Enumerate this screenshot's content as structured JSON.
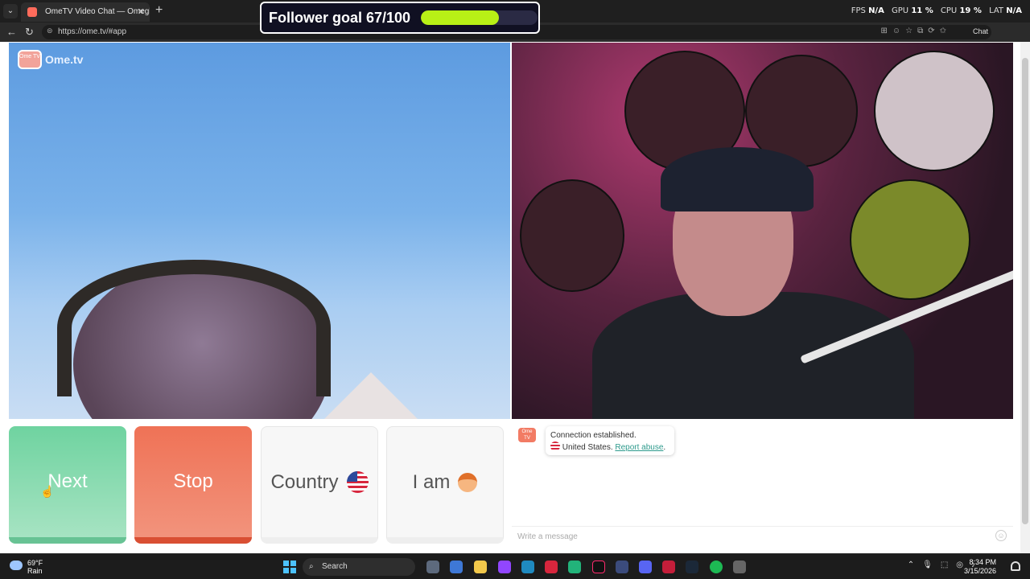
{
  "browser": {
    "tab_title": "OmeTV Video Chat — Omegl",
    "tab_close": "✕",
    "new_tab": "+",
    "url": "https://ome.tv/#app",
    "chat_label": "Chat"
  },
  "stats": {
    "fps_label": "FPS",
    "fps_value": "N/A",
    "gpu_label": "GPU",
    "gpu_value": "11 %",
    "cpu_label": "CPU",
    "cpu_value": "19 %",
    "lat_label": "LAT",
    "lat_value": "N/A"
  },
  "goal": {
    "text": "Follower goal 67/100",
    "current": 67,
    "target": 100,
    "color": "#b8f016"
  },
  "logo": {
    "badge": "Ome TV",
    "name": "Ome.tv"
  },
  "buttons": {
    "next": "Next",
    "stop": "Stop",
    "country": "Country",
    "i_am": "I am"
  },
  "chat": {
    "system_line": "Connection established.",
    "country": "United States.",
    "report": "Report abuse",
    "placeholder": "Write a message"
  },
  "taskbar": {
    "temp": "69°F",
    "condition": "Rain",
    "search": "Search",
    "time": "8:34 PM",
    "date": "3/15/2026"
  },
  "colors": {
    "next": "#6fd3a0",
    "stop": "#ef7256",
    "accent": "#2d9a8c"
  },
  "icons": [
    "search-icon",
    "gear-icon",
    "flag-us-icon",
    "user-avatar-icon",
    "emoji-icon",
    "bell-icon"
  ]
}
